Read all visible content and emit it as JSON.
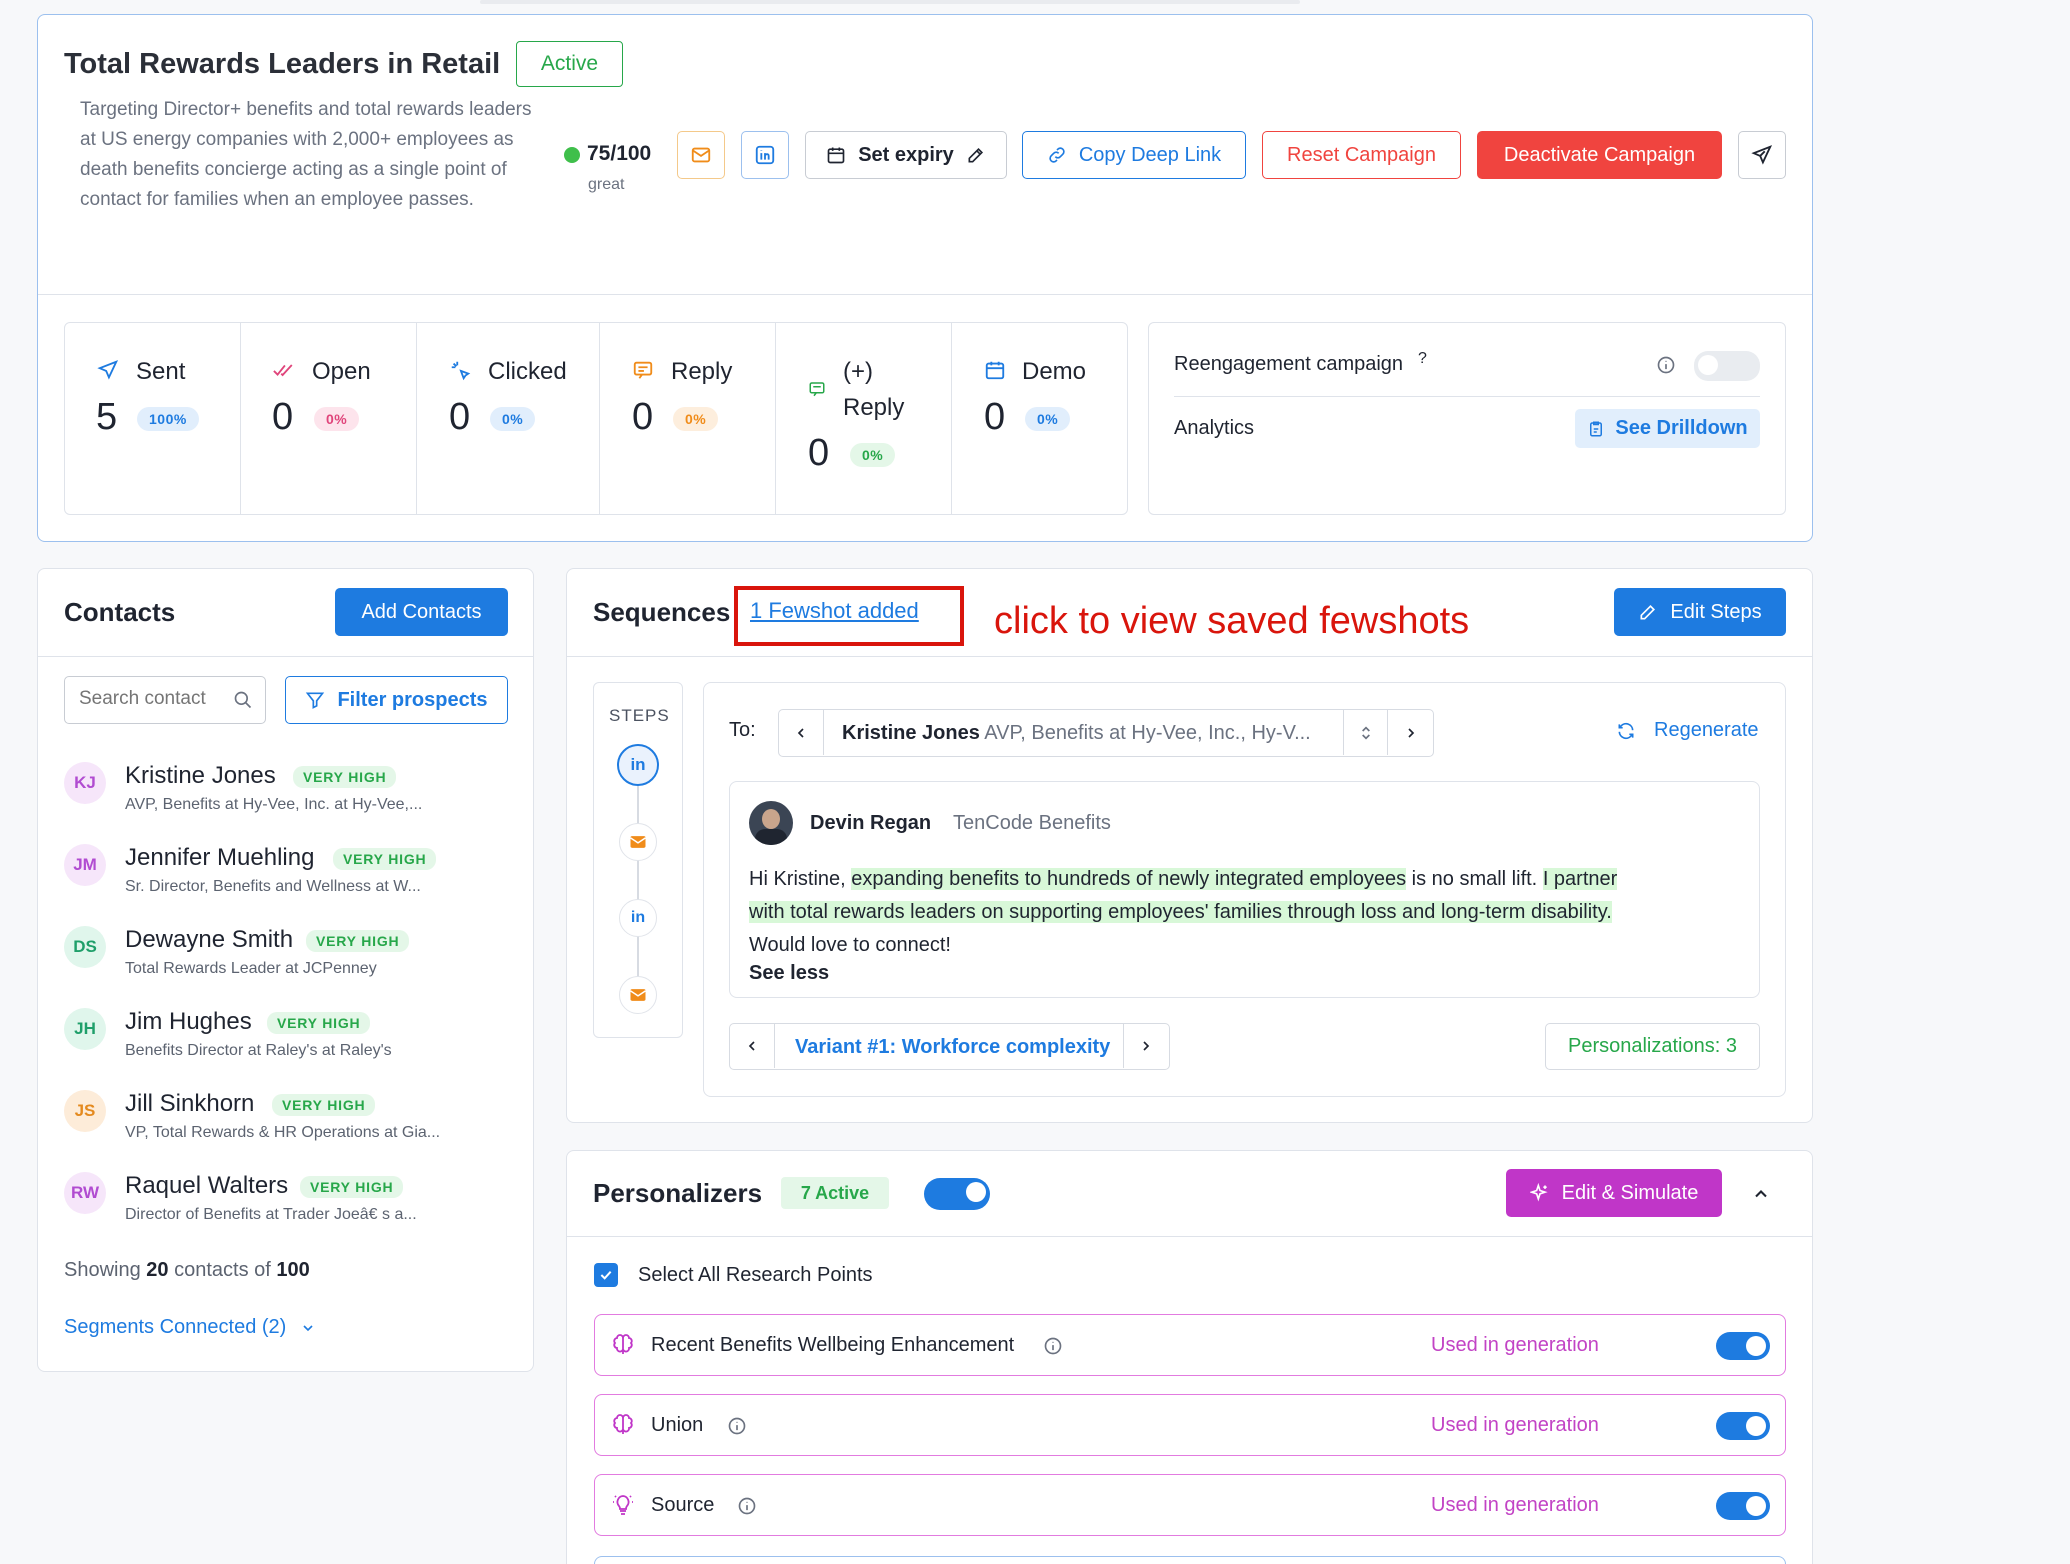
{
  "campaign": {
    "title": "Total Rewards Leaders in Retail",
    "status": "Active",
    "description": "Targeting Director+ benefits and total rewards leaders at US energy companies with 2,000+ employees as death benefits concierge acting as a single point of contact for families when an employee passes.",
    "score": "75/100",
    "score_label": "great",
    "set_expiry": "Set expiry",
    "copy_link": "Copy Deep Link",
    "reset": "Reset Campaign",
    "deactivate": "Deactivate Campaign"
  },
  "stats": [
    {
      "label": "Sent",
      "value": "5",
      "pct": "100%"
    },
    {
      "label": "Open",
      "value": "0",
      "pct": "0%"
    },
    {
      "label": "Clicked",
      "value": "0",
      "pct": "0%"
    },
    {
      "label": "Reply",
      "value": "0",
      "pct": "0%"
    },
    {
      "label": "(+) Reply",
      "label_line1": "(+)",
      "label_line2": "Reply",
      "value": "0",
      "pct": "0%"
    },
    {
      "label": "Demo",
      "value": "0",
      "pct": "0%"
    }
  ],
  "side_panel": {
    "reengagement": "Reengagement campaign",
    "help": "?",
    "analytics": "Analytics",
    "drilldown": "See Drilldown"
  },
  "contacts": {
    "title": "Contacts",
    "add_button": "Add Contacts",
    "search_placeholder": "Search contact",
    "filter_button": "Filter prospects",
    "items": [
      {
        "initials": "KJ",
        "name": "Kristine Jones",
        "badge": "VERY HIGH",
        "subtitle": "AVP, Benefits at Hy-Vee, Inc. at Hy-Vee,..."
      },
      {
        "initials": "JM",
        "name": "Jennifer Muehling",
        "badge": "VERY HIGH",
        "subtitle": "Sr. Director, Benefits and Wellness at W..."
      },
      {
        "initials": "DS",
        "name": "Dewayne Smith",
        "badge": "VERY HIGH",
        "subtitle": "Total Rewards Leader at JCPenney"
      },
      {
        "initials": "JH",
        "name": "Jim Hughes",
        "badge": "VERY HIGH",
        "subtitle": "Benefits Director at Raley's at Raley's"
      },
      {
        "initials": "JS",
        "name": "Jill Sinkhorn",
        "badge": "VERY HIGH",
        "subtitle": "VP, Total Rewards & HR Operations at Gia..."
      },
      {
        "initials": "RW",
        "name": "Raquel Walters",
        "badge": "VERY HIGH",
        "subtitle": "Director of Benefits at Trader Joeâ€   s a..."
      }
    ],
    "showing_prefix": "Showing",
    "showing_count": "20",
    "showing_mid": "contacts of",
    "showing_total": "100",
    "segments": "Segments Connected (2)"
  },
  "sequences": {
    "title": "Sequences",
    "fewshot_link": "1 Fewshot added",
    "annotation": "click to view saved fewshots",
    "edit_steps": "Edit Steps",
    "steps_label": "STEPS",
    "to_label": "To:",
    "recipient_name": "Kristine Jones",
    "recipient_detail": "AVP, Benefits at Hy-Vee, Inc., Hy-V...",
    "regenerate": "Regenerate",
    "sender_name": "Devin Regan",
    "sender_company": "TenCode Benefits",
    "msg_greeting": "Hi Kristine,",
    "msg_hl1": "expanding benefits to hundreds of newly integrated employees",
    "msg_mid": "is no small lift.",
    "msg_hl2a": "I partner",
    "msg_hl2b": "with total rewards leaders on supporting employees' families through loss and long-term disability.",
    "msg_end": "Would love to connect!",
    "see_less": "See less",
    "variant": "Variant #1: Workforce complexity",
    "personalizations": "Personalizations: 3"
  },
  "personalizers": {
    "title": "Personalizers",
    "active_badge": "7 Active",
    "edit_simulate": "Edit & Simulate",
    "select_all": "Select All Research Points",
    "items": [
      {
        "label": "Recent Benefits Wellbeing Enhancement",
        "status": "Used in generation"
      },
      {
        "label": "Union",
        "status": "Used in generation"
      },
      {
        "label": "Source",
        "status": "Used in generation"
      }
    ]
  },
  "colors": {
    "primary": "#1e7be0",
    "danger": "#f0443f",
    "success": "#27a74a",
    "purple": "#c036c8",
    "annotation": "#d9150c"
  }
}
